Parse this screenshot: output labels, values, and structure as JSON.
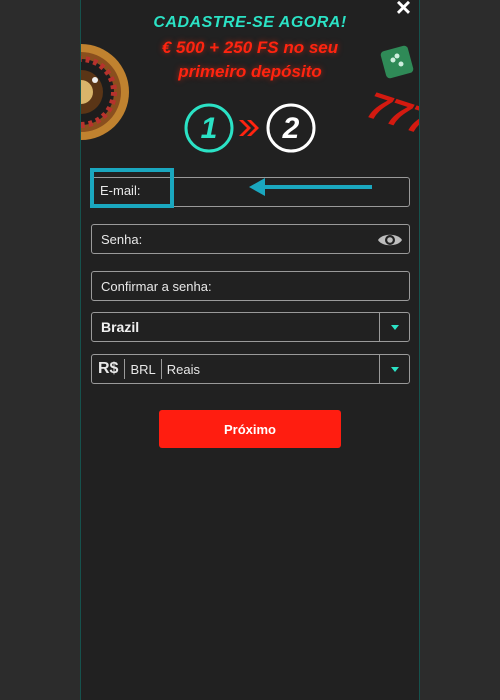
{
  "header": {
    "title": "CADASTRE-SE AGORA!",
    "bonus_line1": "€ 500 + 250 FS no seu",
    "bonus_line2": "primeiro depósito"
  },
  "steps": [
    {
      "label": "1",
      "active": true
    },
    {
      "label": "2",
      "active": false
    }
  ],
  "form": {
    "email_label": "E-mail:",
    "password_label": "Senha:",
    "confirm_password_label": "Confirmar a senha:",
    "country_value": "Brazil",
    "currency_symbol": "R$",
    "currency_code": "BRL",
    "currency_name": "Reais",
    "next_label": "Próximo"
  },
  "colors": {
    "accent": "#2be2c5",
    "brand_red": "#ff1d10",
    "highlight": "#1aa7bf"
  },
  "icons": {
    "close": "close-icon",
    "eye": "eye-icon",
    "dropdown": "chevron-down-icon",
    "step_arrow": "double-chevron-right-icon"
  }
}
